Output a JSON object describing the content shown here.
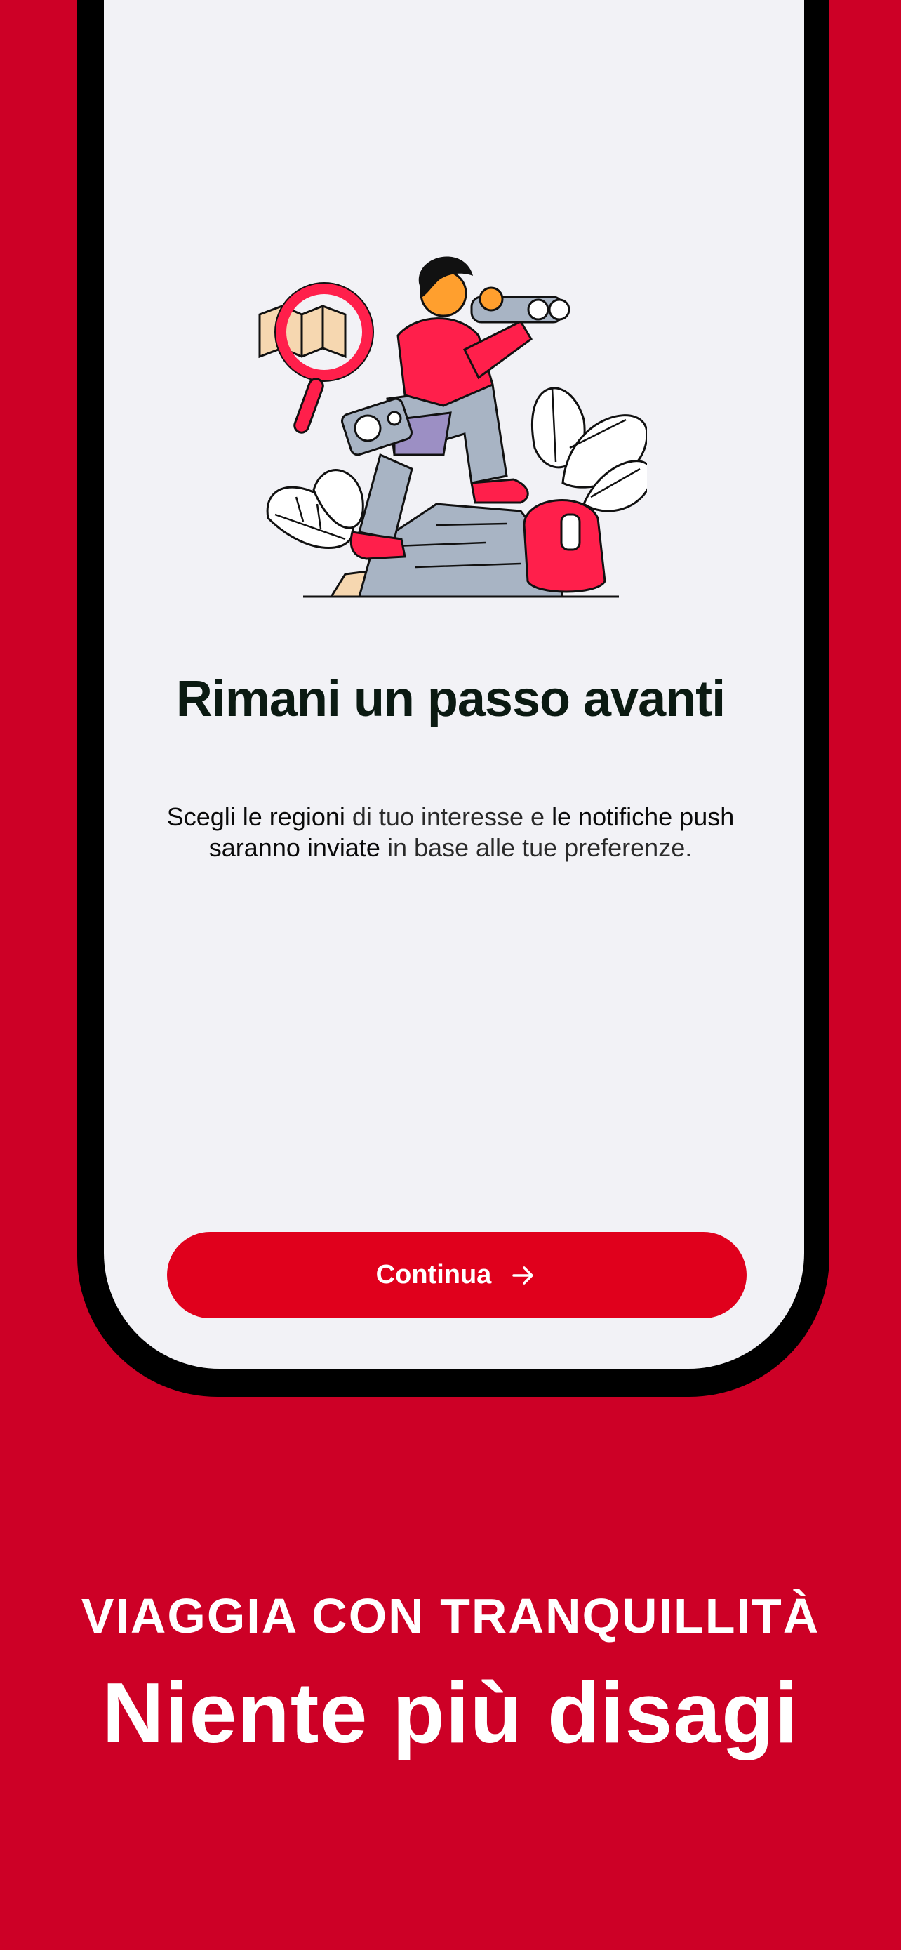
{
  "onboarding": {
    "title": "Rimani un passo avanti",
    "description_parts": [
      {
        "text": "Scegli le regioni",
        "style": "strong"
      },
      {
        "text": " di tuo interesse e ",
        "style": "normal"
      },
      {
        "text": "le notifiche push saranno inviate",
        "style": "strong"
      },
      {
        "text": " in base alle tue preferenze.",
        "style": "normal"
      }
    ],
    "continue_label": "Continua",
    "illustration_icon": "explorer-with-binoculars-illustration"
  },
  "promo": {
    "tagline": "VIAGGIA CON TRANQUILLITÀ",
    "headline": "Niente più disagi"
  },
  "colors": {
    "background": "#cd0026",
    "button": "#e0001c",
    "screen": "#f2f2f6",
    "title": "#0b1a12"
  }
}
